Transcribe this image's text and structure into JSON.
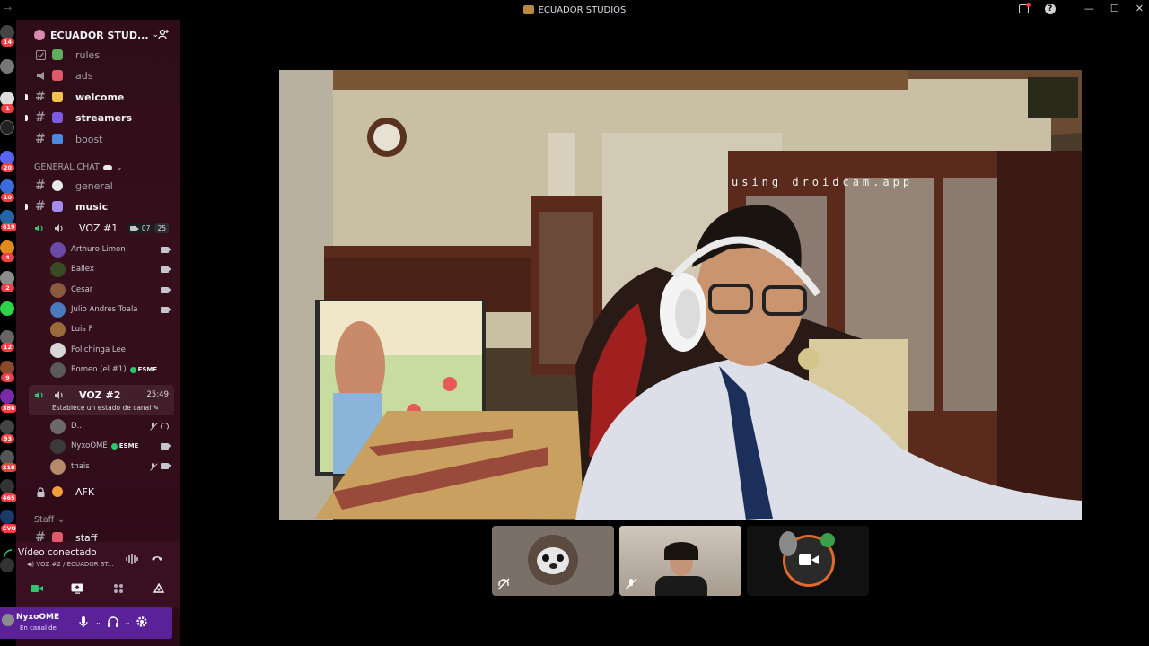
{
  "window": {
    "title": "ECUADOR STUDIOS"
  },
  "server_rail": {
    "badges": [
      "14",
      "1",
      "20",
      "10",
      "619",
      "4",
      "2",
      "12",
      "9",
      "386",
      "93",
      "218",
      "465",
      "EVO"
    ]
  },
  "guild": {
    "name": "ECUADOR STUD..."
  },
  "channels_top": [
    {
      "name": "rules",
      "type": "rules",
      "unread": false
    },
    {
      "name": "ads",
      "type": "announcement",
      "unread": false
    },
    {
      "name": "welcome",
      "type": "text",
      "unread": true
    },
    {
      "name": "streamers",
      "type": "text",
      "unread": true
    },
    {
      "name": "boost",
      "type": "text",
      "unread": false
    }
  ],
  "category_general": {
    "label": "GENERAL CHAT"
  },
  "channels_general": [
    {
      "name": "general",
      "unread": false
    },
    {
      "name": "music",
      "unread": true
    }
  ],
  "voz1": {
    "name": "VOZ #1",
    "video_count": "07",
    "user_limit": "25",
    "users": [
      {
        "name": "Arthuro Limon",
        "avatar_color": "#6b4aa8"
      },
      {
        "name": "Ballex",
        "avatar_color": "#3a4a22"
      },
      {
        "name": "Cesar",
        "avatar_color": "#8a5a40"
      },
      {
        "name": "Julio Andres Toala",
        "avatar_color": "#4a7abf"
      },
      {
        "name": "Luis F",
        "avatar_color": "#9a6a3a"
      },
      {
        "name": "Polichinga Lee",
        "avatar_color": "#d7d7d7"
      },
      {
        "name": "Romeo (el #1)",
        "avatar_color": "#5a5a5a",
        "role": "ESME"
      }
    ]
  },
  "voz2": {
    "name": "VOZ #2",
    "timer": "25:49",
    "status": "Establece un estado de canal",
    "users": [
      {
        "name": "D...",
        "avatar_color": "#6a6a6a"
      },
      {
        "name": "NyxoOME",
        "avatar_color": "#3a3a3a",
        "role": "ESME"
      },
      {
        "name": "thais",
        "avatar_color": "#b48a6a"
      }
    ]
  },
  "afk_channel": {
    "name": "AFK"
  },
  "category_staff": {
    "label": "Staff"
  },
  "staff_channel": {
    "name": "staff"
  },
  "rtc": {
    "status": "Vídeo conectado",
    "sub": "VOZ #2 / ECUADOR ST..."
  },
  "user_panel": {
    "username": "NyxoOME",
    "status": "En canal de"
  },
  "main_video": {
    "watermark": "using droidcam.app"
  },
  "colors": {
    "sidebar_bg": "#320d1a",
    "user_panel_bg": "#5a2198",
    "speaking_green": "#2dc770",
    "badge_red": "#f23f43"
  }
}
